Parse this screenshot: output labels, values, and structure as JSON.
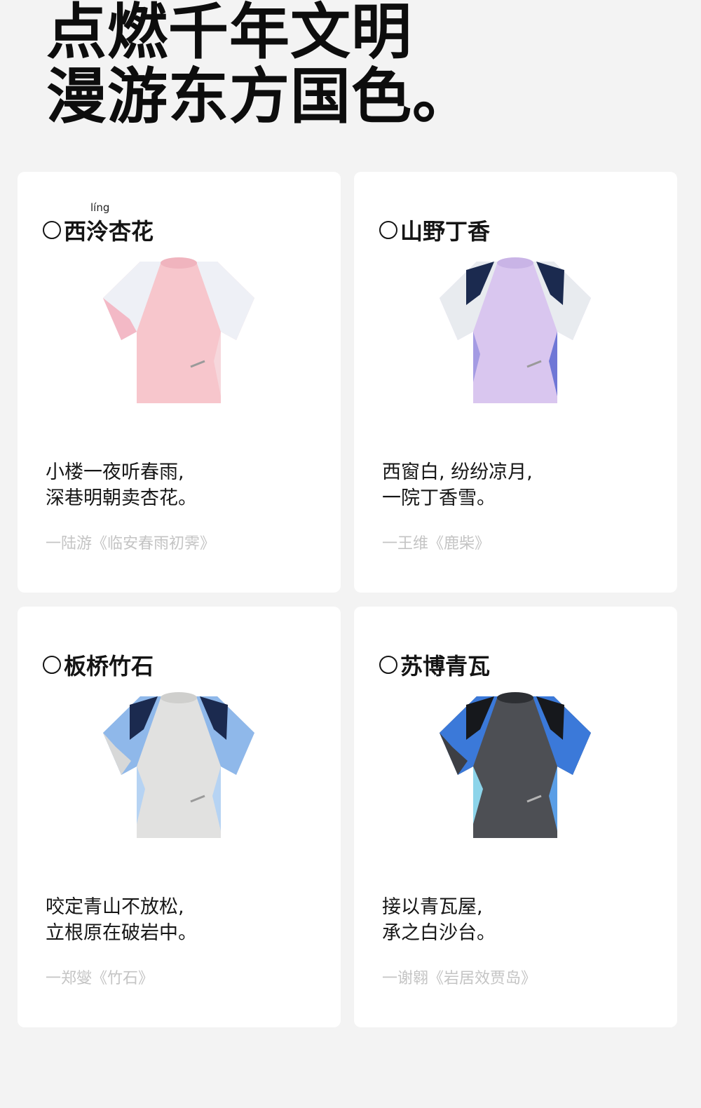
{
  "headline": {
    "line1": "点燃千年文明",
    "line2": "漫游东方国色。"
  },
  "cards": [
    {
      "title": "西泠杏花",
      "pinyin": "líng",
      "verse1": "小楼一夜听春雨,",
      "verse2": "深巷明朝卖杏花。",
      "source": "一陆游《临安春雨初霁》",
      "colors": {
        "body": "#f7c6cc",
        "sleeve": "#eef0f6",
        "yoke": "#f3b9c6",
        "accent": "#f6d7dc"
      }
    },
    {
      "title": "山野丁香",
      "verse1": "西窗白, 纷纷凉月,",
      "verse2": "一院丁香雪。",
      "source": "一王维《鹿柴》",
      "colors": {
        "body": "#d9c6ef",
        "sleeve": "#e8ebef",
        "yoke": "#1b2a4f",
        "accent": "#6f77d6"
      }
    },
    {
      "title": "板桥竹石",
      "verse1": "咬定青山不放松,",
      "verse2": "立根原在破岩中。",
      "source": "一郑燮《竹石》",
      "colors": {
        "body": "#e1e1e0",
        "sleeve": "#8fb8ea",
        "yoke": "#1b2a4f",
        "accent": "#b6d3f3"
      }
    },
    {
      "title": "苏博青瓦",
      "verse1": "接以青瓦屋,",
      "verse2": "承之白沙台。",
      "source": "一谢翱《岩居效贾岛》",
      "colors": {
        "body": "#4d4f54",
        "sleeve": "#3b79d9",
        "yoke": "#16181c",
        "accent": "#8cd4ea"
      }
    }
  ]
}
